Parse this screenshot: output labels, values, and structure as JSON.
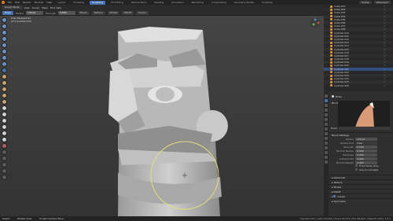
{
  "menubar": {
    "menus": [
      "File",
      "Edit",
      "Render",
      "Window",
      "Help"
    ],
    "workspaces": [
      "Layout",
      "Modeling",
      "Sculpting",
      "UV Editing",
      "Texture Paint",
      "Shading",
      "Animation",
      "Rendering",
      "Compositing",
      "Geometry Nodes",
      "Scripting"
    ],
    "active_workspace": "Sculpting",
    "scene": "Scene",
    "view_layer": "ViewLayer"
  },
  "header": {
    "mode": "Sculpt Mode",
    "view_menus": [
      "View",
      "Sculpt",
      "Mask",
      "Face Sets"
    ],
    "radius_label": "Radius",
    "radius_value": "130 px",
    "strength_label": "Strength",
    "strength_value": "0.500",
    "brush_settings": [
      "Brush",
      "Texture",
      "Stroke",
      "Falloff",
      "Cursor"
    ]
  },
  "overlay": {
    "line1": "User Perspective",
    "line2": "(27) Cylinder.013"
  },
  "outliner": {
    "items": [
      "Cube.031",
      "Cube.032",
      "Cube.033",
      "Cube.034",
      "Cube.035",
      "Cube.036",
      "Cube.037",
      "Cube.038",
      "Cylinder.010",
      "Cylinder.011",
      "Cylinder.012",
      "Cylinder.013",
      "Cylinder.014",
      "Cylinder.015",
      "Cylinder.016",
      "Cylinder.017",
      "Cylinder.018",
      "Cylinder.019",
      "Cylinder.020",
      "Cylinder.021",
      "Cylinder.022",
      "Cylinder.023",
      "Cylinder.024",
      "Cylinder.025",
      "Cylinder.026"
    ],
    "selected_index": 19
  },
  "properties": {
    "brush_name": "Draw",
    "preview_label": "Draw",
    "section_brush": "Brush",
    "section_settings": "Brush Settings",
    "rows": [
      {
        "label": "Radius",
        "value": "130 px"
      },
      {
        "label": "Radius Unit",
        "value": "View"
      },
      {
        "label": "Strength",
        "value": "0.500"
      },
      {
        "label": "Normal Radius",
        "value": "0.500"
      },
      {
        "label": "Hardness",
        "value": "0.000"
      },
      {
        "label": "Autosmooth",
        "value": "0.000"
      },
      {
        "label": "Normal Weight",
        "value": "0.000"
      }
    ],
    "checkboxes": [
      {
        "label": "Front Faces Only",
        "on": false
      },
      {
        "label": "Use Accumulate",
        "on": false
      }
    ],
    "sections": [
      "Advanced",
      "Texture",
      "Stroke",
      "Falloff",
      "Cursor",
      "Symmetry"
    ],
    "cursor_on": true
  },
  "status": {
    "left1": "Select",
    "left2": "Rotate View",
    "left3": "Sculpt Context Menu",
    "right": "Cylinder.013 | Verts 24,516 | Faces 24,312 | Tris 48,624 | Objects 1/40 | 3.4.1"
  },
  "colors": {
    "accent": "#4772b3",
    "brush_cursor": "#e6df78",
    "object_orange": "#e0903a"
  }
}
